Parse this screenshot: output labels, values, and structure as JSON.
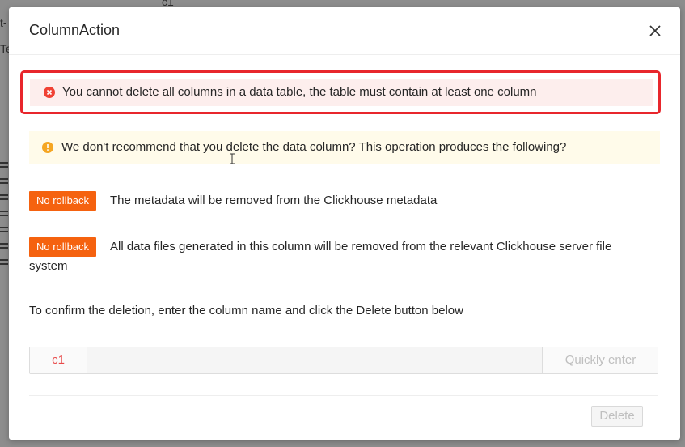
{
  "background": {
    "top_text": "c1",
    "left_fragments": [
      "t-",
      "Te"
    ]
  },
  "modal": {
    "title": "ColumnAction",
    "close_icon": "close-icon"
  },
  "error_alert": {
    "icon": "error-circle-icon",
    "color": "#e8262c",
    "text": "You cannot delete all columns in a data table, the table must contain at least one column"
  },
  "warning_alert": {
    "icon": "warning-circle-icon",
    "color": "#f5a623",
    "text": "We don't recommend that you delete the data column? This operation produces the following?"
  },
  "consequences": [
    {
      "tag": "No rollback",
      "text": "The metadata will be removed from the Clickhouse metadata"
    },
    {
      "tag": "No rollback",
      "text_line1": "All data files generated in this column will be removed from the relevant Clickhouse server file",
      "text_line2": "system"
    }
  ],
  "tag_color": "#f5620f",
  "confirm": {
    "instruction": "To confirm the deletion, enter the column name and click the Delete button below",
    "column_name": "c1",
    "input_value": "",
    "quick_enter_label": "Quickly enter"
  },
  "footer": {
    "delete_label": "Delete"
  }
}
